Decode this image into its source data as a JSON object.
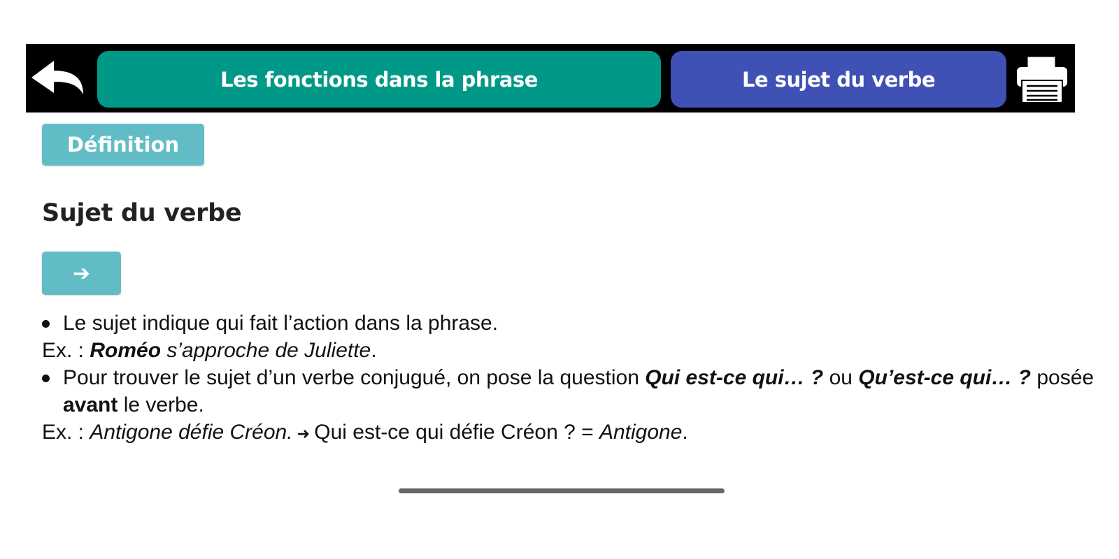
{
  "header": {
    "back_icon": "back-arrow-icon",
    "chapter_label": "Les fonctions dans la phrase",
    "lesson_label": "Le sujet du verbe",
    "print_icon": "printer-icon",
    "colors": {
      "bar": "#000000",
      "chapter_pill": "#009987",
      "lesson_pill": "#3f51b5"
    }
  },
  "definition_button": {
    "label": "Définition",
    "color": "#62bcc6"
  },
  "section": {
    "title": "Sujet du verbe",
    "next_button_symbol": "➔"
  },
  "content": {
    "bullet1": "Le sujet indique qui fait l’action dans la phrase.",
    "example1": {
      "prefix": "Ex. : ",
      "subject": "Roméo",
      "rest": " s’approche de Juliette",
      "end": "."
    },
    "bullet2": {
      "part1": "Pour trouver le sujet d’un verbe conjugué, on pose la question ",
      "question1": "Qui est-ce qui… ?",
      "or": " ou ",
      "question2": "Qu’est-ce qui… ?",
      "part2": " posée ",
      "before": "avant",
      "part3": " le verbe."
    },
    "example2": {
      "prefix": "Ex. : ",
      "sentence": "Antigone défie Créon.",
      "arrow": " ➜ ",
      "question": "Qui est-ce qui défie Créon ? = ",
      "answer": "Antigone",
      "end": "."
    }
  }
}
